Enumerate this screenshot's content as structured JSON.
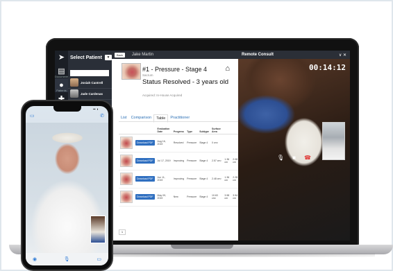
{
  "rail": {
    "icons": [
      "compass-icon",
      "document-icon",
      "user-icon",
      "medical-cross-icon"
    ],
    "labels": [
      "",
      "Documents",
      "Patients",
      ""
    ]
  },
  "patients_panel": {
    "title": "Select Patient",
    "dropdown_glyph": "▼",
    "patients": [
      {
        "name": "Josiah Cantrell"
      },
      {
        "name": "Jade Cardenas"
      }
    ]
  },
  "topbar": {
    "back_label": "Back",
    "patient_name": "Jake Martin"
  },
  "wound": {
    "title": "#1 - Pressure - Stage 4",
    "location": "Sacrum",
    "status": "Status Resolved - 3 years old",
    "acquired": "Acquired: In-House Acquired"
  },
  "tabs": [
    {
      "label": "List",
      "active": false
    },
    {
      "label": "Comparison",
      "active": false
    },
    {
      "label": "Table",
      "active": true
    },
    {
      "label": "Practitioner",
      "active": false
    }
  ],
  "table": {
    "headers": [
      "",
      "",
      "Evaluation Date",
      "Progress",
      "Type",
      "Subtype",
      "Surface Area",
      "",
      "",
      "",
      "",
      "",
      "",
      ""
    ],
    "rows": [
      {
        "pdf": "Download PDF",
        "date": "Aug 16, 2019",
        "progress": "Resolved",
        "type": "Pressure",
        "subtype": "Stage 4",
        "area": "0 cm²",
        "c1": "",
        "c2": "",
        "c3": "",
        "c4": "",
        "c5": "",
        "c6": "",
        "lock": false
      },
      {
        "pdf": "Download PDF",
        "date": "Jul 17, 2019",
        "progress": "Improving",
        "type": "Pressure",
        "subtype": "Stage 4",
        "area": "2.57 cm²",
        "c1": "1.36 cm",
        "c2": "2.08 cm",
        "c3": "0.3 cm",
        "c4": "INC",
        "c5": "Generic wound cleanser",
        "c6": "Antimicrobial",
        "lock": true
      },
      {
        "pdf": "Download PDF",
        "date": "Jun 11, 2019",
        "progress": "Improving",
        "type": "Pressure",
        "subtype": "Stage 4",
        "area": "2.48 cm²",
        "c1": "1.36 cm",
        "c2": "2.28 cm",
        "c3": "1 cm",
        "c4": "INC",
        "c5": "Generic wound cleanser",
        "c6": "Antimicrobial",
        "lock": true
      },
      {
        "pdf": "Download PDF",
        "date": "May 09, 2019",
        "progress": "New",
        "type": "Pressure",
        "subtype": "Stage 4",
        "area": "10.63 cm²",
        "c1": "3.58 cm",
        "c2": "3.94 cm",
        "c3": "1.8 cm",
        "c4": "13",
        "c5": "Acetic acid",
        "c6": "Hydrogel",
        "lock": true
      }
    ],
    "pager": "1"
  },
  "consult": {
    "title": "Remote Consult",
    "controls": "∨  ✕",
    "timer": "00:14:12"
  },
  "call_controls": [
    {
      "name": "microphone-icon",
      "glyph": "🎙"
    },
    {
      "name": "video-camera-icon",
      "glyph": "■"
    },
    {
      "name": "end-call-icon",
      "glyph": "☎"
    }
  ],
  "phone": {
    "status_time": "",
    "status_right": "▪▪ ◗",
    "top_left_glyph": "▭",
    "top_right_glyph": "✆",
    "bottom_left_glyph": "◉",
    "bottom_mid_glyph": "🎙",
    "bottom_right_glyph": "▭"
  },
  "colors": {
    "accent_blue": "#2f6fc0",
    "dark_panel": "#2a2f38",
    "end_call_red": "#e0322f"
  }
}
